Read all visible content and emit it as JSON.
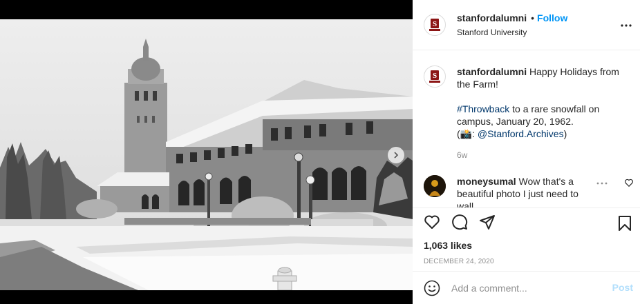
{
  "post": {
    "image_alt": "Stanford main quad and Hoover Tower in snow",
    "header": {
      "username": "stanfordalumni",
      "separator": "•",
      "follow_label": "Follow",
      "location": "Stanford University"
    },
    "caption": {
      "username": "stanfordalumni",
      "line1": "Happy Holidays from the Farm!",
      "hashtag": "#Throwback",
      "line2": " to a rare snowfall on campus, January 20, 1962.",
      "credit_prefix": "(📸: ",
      "mention": "@Stanford.Archives",
      "credit_suffix": ")",
      "age": "6w"
    },
    "comment": {
      "username": "moneysumal",
      "text": "Wow that's a beautiful photo I just need to wall"
    },
    "likes": "1,063 likes",
    "date": "DECEMBER 24, 2020",
    "add_comment": {
      "placeholder": "Add a comment...",
      "post_label": "Post"
    }
  },
  "colors": {
    "accent": "#0095f6",
    "link": "#00376b",
    "post_disabled": "#b2dffc",
    "muted": "#8e8e8e",
    "brand_cardinal": "#8c1515"
  }
}
